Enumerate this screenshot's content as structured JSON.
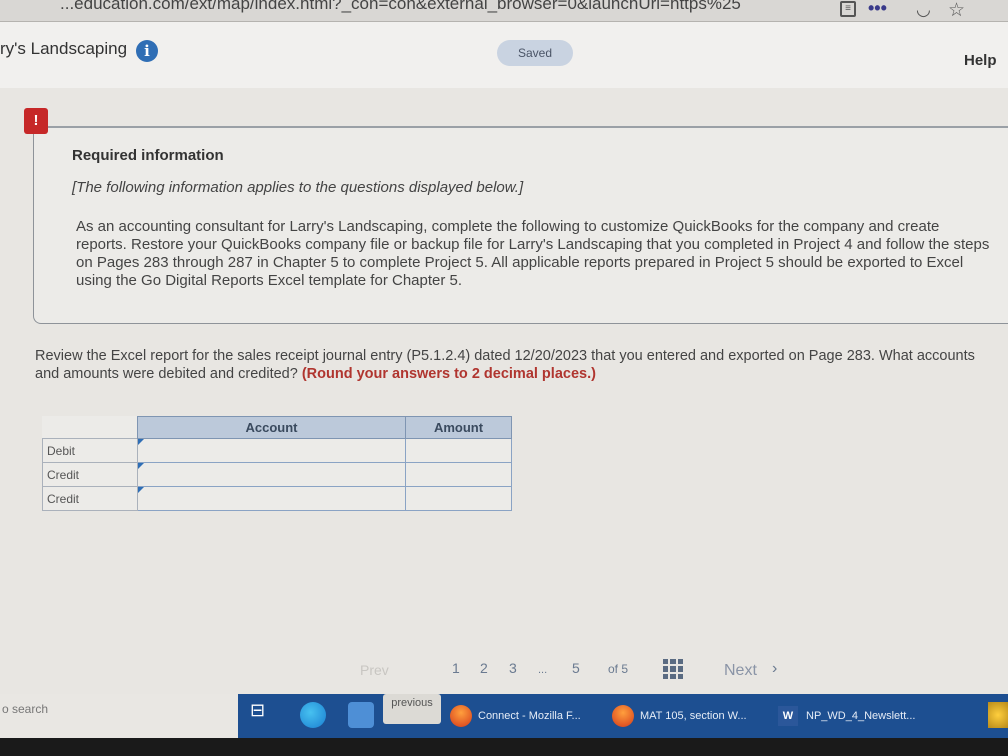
{
  "browser": {
    "url_fragment": "...education.com/ext/map/index.html?_con=con&external_browser=0&launchUrl=https%25"
  },
  "header": {
    "brand": "ry's Landscaping",
    "saved_label": "Saved",
    "help_label": "Help"
  },
  "alert_symbol": "!",
  "required_info": {
    "title": "Required information",
    "subtitle": "[The following information applies to the questions displayed below.]",
    "body": "As an accounting consultant for Larry's Landscaping, complete the following to customize QuickBooks for the company and create reports. Restore your QuickBooks company file or backup file for Larry's Landscaping that you completed in Project 4 and follow the steps on Pages 283 through 287 in Chapter 5 to complete Project 5. All applicable reports prepared in Project 5 should be exported to Excel using the Go Digital Reports Excel template for Chapter 5."
  },
  "question": {
    "text": "Review the Excel report for the sales receipt journal entry (P5.1.2.4) dated 12/20/2023 that you entered and exported on Page 283. What accounts and amounts were debited and credited?",
    "emphasis": "(Round your answers to 2 decimal places.)"
  },
  "table": {
    "headers": {
      "account": "Account",
      "amount": "Amount"
    },
    "rows": [
      {
        "label": "Debit",
        "account": "",
        "amount": ""
      },
      {
        "label": "Credit",
        "account": "",
        "amount": ""
      },
      {
        "label": "Credit",
        "account": "",
        "amount": ""
      }
    ]
  },
  "pagination": {
    "prev_label": "Prev",
    "pages": [
      "1",
      "2",
      "3",
      "...",
      "5"
    ],
    "of_label": "of 5",
    "next_label": "Next"
  },
  "taskbar": {
    "search_label": "o search",
    "previous_label": "previous",
    "apps": [
      {
        "label": "Connect - Mozilla F..."
      },
      {
        "label": "MAT 105, section W..."
      },
      {
        "label": "NP_WD_4_Newslett..."
      }
    ]
  },
  "colors": {
    "accent": "#2f6eb5",
    "alert": "#c62828",
    "emphasis": "#b0352f",
    "taskbar": "#1d4f91"
  }
}
